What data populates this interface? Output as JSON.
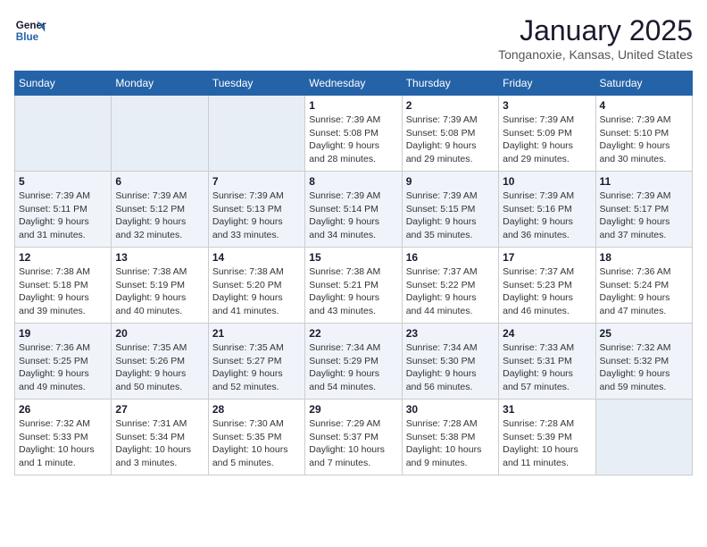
{
  "logo": {
    "line1": "General",
    "line2": "Blue"
  },
  "title": "January 2025",
  "subtitle": "Tonganoxie, Kansas, United States",
  "days_of_week": [
    "Sunday",
    "Monday",
    "Tuesday",
    "Wednesday",
    "Thursday",
    "Friday",
    "Saturday"
  ],
  "weeks": [
    [
      {
        "day": "",
        "info": ""
      },
      {
        "day": "",
        "info": ""
      },
      {
        "day": "",
        "info": ""
      },
      {
        "day": "1",
        "info": "Sunrise: 7:39 AM\nSunset: 5:08 PM\nDaylight: 9 hours\nand 28 minutes."
      },
      {
        "day": "2",
        "info": "Sunrise: 7:39 AM\nSunset: 5:08 PM\nDaylight: 9 hours\nand 29 minutes."
      },
      {
        "day": "3",
        "info": "Sunrise: 7:39 AM\nSunset: 5:09 PM\nDaylight: 9 hours\nand 29 minutes."
      },
      {
        "day": "4",
        "info": "Sunrise: 7:39 AM\nSunset: 5:10 PM\nDaylight: 9 hours\nand 30 minutes."
      }
    ],
    [
      {
        "day": "5",
        "info": "Sunrise: 7:39 AM\nSunset: 5:11 PM\nDaylight: 9 hours\nand 31 minutes."
      },
      {
        "day": "6",
        "info": "Sunrise: 7:39 AM\nSunset: 5:12 PM\nDaylight: 9 hours\nand 32 minutes."
      },
      {
        "day": "7",
        "info": "Sunrise: 7:39 AM\nSunset: 5:13 PM\nDaylight: 9 hours\nand 33 minutes."
      },
      {
        "day": "8",
        "info": "Sunrise: 7:39 AM\nSunset: 5:14 PM\nDaylight: 9 hours\nand 34 minutes."
      },
      {
        "day": "9",
        "info": "Sunrise: 7:39 AM\nSunset: 5:15 PM\nDaylight: 9 hours\nand 35 minutes."
      },
      {
        "day": "10",
        "info": "Sunrise: 7:39 AM\nSunset: 5:16 PM\nDaylight: 9 hours\nand 36 minutes."
      },
      {
        "day": "11",
        "info": "Sunrise: 7:39 AM\nSunset: 5:17 PM\nDaylight: 9 hours\nand 37 minutes."
      }
    ],
    [
      {
        "day": "12",
        "info": "Sunrise: 7:38 AM\nSunset: 5:18 PM\nDaylight: 9 hours\nand 39 minutes."
      },
      {
        "day": "13",
        "info": "Sunrise: 7:38 AM\nSunset: 5:19 PM\nDaylight: 9 hours\nand 40 minutes."
      },
      {
        "day": "14",
        "info": "Sunrise: 7:38 AM\nSunset: 5:20 PM\nDaylight: 9 hours\nand 41 minutes."
      },
      {
        "day": "15",
        "info": "Sunrise: 7:38 AM\nSunset: 5:21 PM\nDaylight: 9 hours\nand 43 minutes."
      },
      {
        "day": "16",
        "info": "Sunrise: 7:37 AM\nSunset: 5:22 PM\nDaylight: 9 hours\nand 44 minutes."
      },
      {
        "day": "17",
        "info": "Sunrise: 7:37 AM\nSunset: 5:23 PM\nDaylight: 9 hours\nand 46 minutes."
      },
      {
        "day": "18",
        "info": "Sunrise: 7:36 AM\nSunset: 5:24 PM\nDaylight: 9 hours\nand 47 minutes."
      }
    ],
    [
      {
        "day": "19",
        "info": "Sunrise: 7:36 AM\nSunset: 5:25 PM\nDaylight: 9 hours\nand 49 minutes."
      },
      {
        "day": "20",
        "info": "Sunrise: 7:35 AM\nSunset: 5:26 PM\nDaylight: 9 hours\nand 50 minutes."
      },
      {
        "day": "21",
        "info": "Sunrise: 7:35 AM\nSunset: 5:27 PM\nDaylight: 9 hours\nand 52 minutes."
      },
      {
        "day": "22",
        "info": "Sunrise: 7:34 AM\nSunset: 5:29 PM\nDaylight: 9 hours\nand 54 minutes."
      },
      {
        "day": "23",
        "info": "Sunrise: 7:34 AM\nSunset: 5:30 PM\nDaylight: 9 hours\nand 56 minutes."
      },
      {
        "day": "24",
        "info": "Sunrise: 7:33 AM\nSunset: 5:31 PM\nDaylight: 9 hours\nand 57 minutes."
      },
      {
        "day": "25",
        "info": "Sunrise: 7:32 AM\nSunset: 5:32 PM\nDaylight: 9 hours\nand 59 minutes."
      }
    ],
    [
      {
        "day": "26",
        "info": "Sunrise: 7:32 AM\nSunset: 5:33 PM\nDaylight: 10 hours\nand 1 minute."
      },
      {
        "day": "27",
        "info": "Sunrise: 7:31 AM\nSunset: 5:34 PM\nDaylight: 10 hours\nand 3 minutes."
      },
      {
        "day": "28",
        "info": "Sunrise: 7:30 AM\nSunset: 5:35 PM\nDaylight: 10 hours\nand 5 minutes."
      },
      {
        "day": "29",
        "info": "Sunrise: 7:29 AM\nSunset: 5:37 PM\nDaylight: 10 hours\nand 7 minutes."
      },
      {
        "day": "30",
        "info": "Sunrise: 7:28 AM\nSunset: 5:38 PM\nDaylight: 10 hours\nand 9 minutes."
      },
      {
        "day": "31",
        "info": "Sunrise: 7:28 AM\nSunset: 5:39 PM\nDaylight: 10 hours\nand 11 minutes."
      },
      {
        "day": "",
        "info": ""
      }
    ]
  ]
}
